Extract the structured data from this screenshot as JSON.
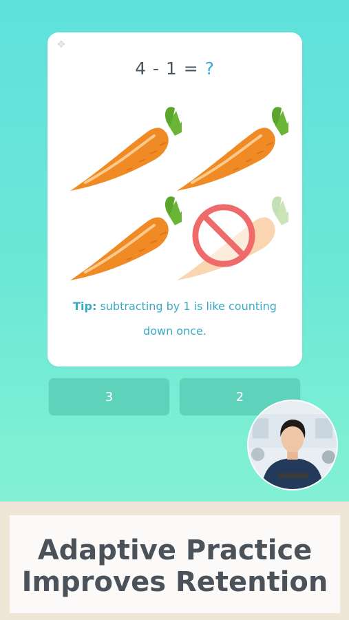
{
  "card": {
    "equation_left": "4 - 1 =",
    "equation_unknown": "?",
    "carrot_icon": "carrot-icon",
    "crossed_out_icon": "no-sign-icon",
    "tip_label": "Tip:",
    "tip_text": "subtracting by 1 is like counting down once."
  },
  "answers": [
    {
      "label": "3"
    },
    {
      "label": "2"
    }
  ],
  "presenter": {
    "icon": "presenter-avatar"
  },
  "banner": {
    "line1": "Adaptive Practice",
    "line2": "Improves Retention"
  },
  "colors": {
    "accent": "#35a8dc",
    "tip": "#37a9c6",
    "answer_bg": "#5fd2bb",
    "carrot": "#f08a24",
    "leaves": "#6ab536",
    "no_sign": "#ef6b6b"
  }
}
